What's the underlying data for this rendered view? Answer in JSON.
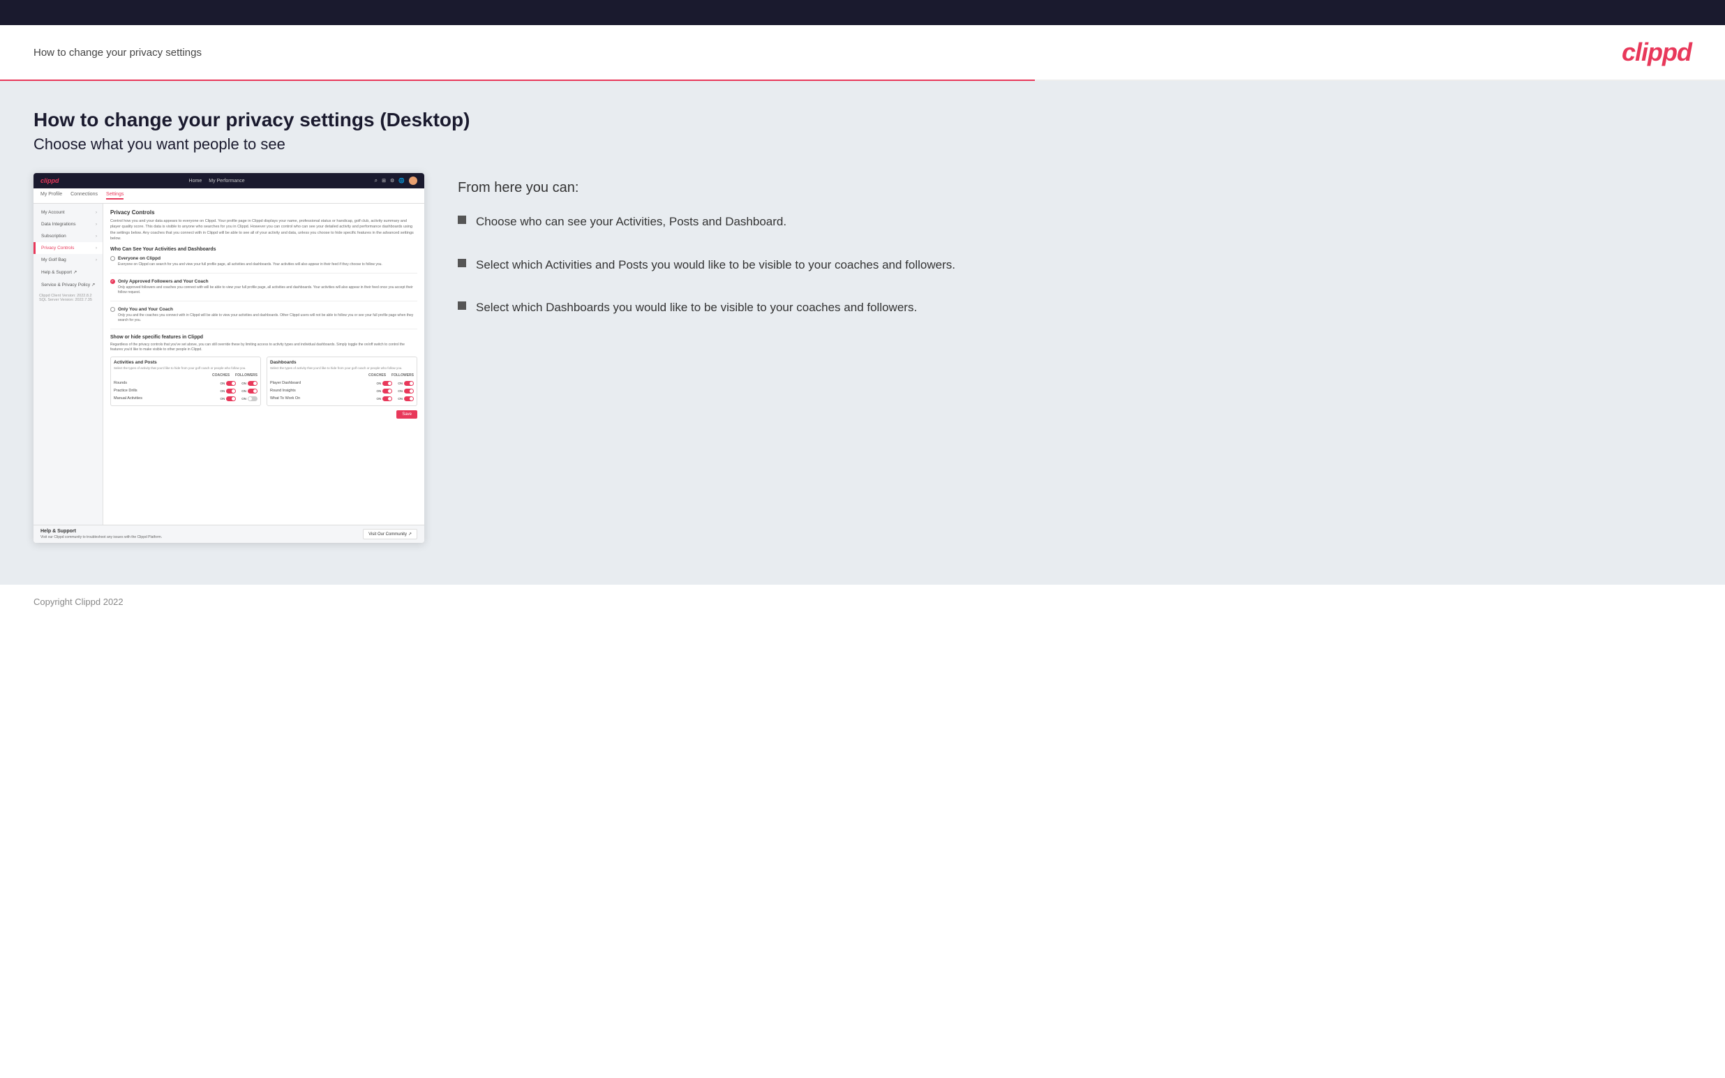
{
  "header": {
    "title": "How to change your privacy settings",
    "logo": "clippd"
  },
  "page": {
    "heading": "How to change your privacy settings (Desktop)",
    "subheading": "Choose what you want people to see",
    "from_here_title": "From here you can:"
  },
  "bullets": [
    {
      "text": "Choose who can see your Activities, Posts and Dashboard."
    },
    {
      "text": "Select which Activities and Posts you would like to be visible to your coaches and followers."
    },
    {
      "text": "Select which Dashboards you would like to be visible to your coaches and followers."
    }
  ],
  "mock": {
    "nav": {
      "logo": "clippd",
      "links": [
        "Home",
        "My Performance"
      ],
      "icons": [
        "search",
        "grid",
        "settings",
        "globe",
        "avatar"
      ]
    },
    "sub_nav": {
      "tabs": [
        "My Profile",
        "Connections",
        "Settings"
      ]
    },
    "sidebar": {
      "items": [
        {
          "label": "My Account",
          "active": false
        },
        {
          "label": "Data Integrations",
          "active": false
        },
        {
          "label": "Subscription",
          "active": false
        },
        {
          "label": "Privacy Controls",
          "active": true
        },
        {
          "label": "My Golf Bag",
          "active": false
        },
        {
          "label": "Help & Support ↗",
          "active": false
        },
        {
          "label": "Service & Privacy Policy ↗",
          "active": false
        }
      ],
      "footer": {
        "line1": "Clippd Client Version: 2022.8.2",
        "line2": "SQL Server Version: 2022.7.35"
      }
    },
    "main": {
      "section_title": "Privacy Controls",
      "description": "Control how you and your data appears to everyone on Clippd. Your profile page in Clippd displays your name, professional status or handicap, golf club, activity summary and player quality score. This data is visible to anyone who searches for you in Clippd. However you can control who can see your detailed activity and performance dashboards using the settings below. Any coaches that you connect with in Clippd will be able to see all of your activity and data, unless you choose to hide specific features in the advanced settings below.",
      "who_can_see_title": "Who Can See Your Activities and Dashboards",
      "radio_options": [
        {
          "label": "Everyone on Clippd",
          "description": "Everyone on Clippd can search for you and view your full profile page, all activities and dashboards. Your activities will also appear in their feed if they choose to follow you.",
          "selected": false
        },
        {
          "label": "Only Approved Followers and Your Coach",
          "description": "Only approved followers and coaches you connect with will be able to view your full profile page, all activities and dashboards. Your activities will also appear in their feed once you accept their follow request.",
          "selected": true
        },
        {
          "label": "Only You and Your Coach",
          "description": "Only you and the coaches you connect with in Clippd will be able to view your activities and dashboards. Other Clippd users will not be able to follow you or see your full profile page when they search for you.",
          "selected": false
        }
      ],
      "show_hide_title": "Show or hide specific features in Clippd",
      "show_hide_desc": "Regardless of the privacy controls that you've set above, you can still override these by limiting access to activity types and individual dashboards. Simply toggle the on/off switch to control the features you'd like to make visible to other people in Clippd.",
      "activities_panel": {
        "title": "Activities and Posts",
        "desc": "Select the types of activity that you'd like to hide from your golf coach or people who follow you.",
        "headers": [
          "COACHES",
          "FOLLOWERS"
        ],
        "rows": [
          {
            "label": "Rounds",
            "coaches": "on",
            "followers": "on"
          },
          {
            "label": "Practice Drills",
            "coaches": "on",
            "followers": "on"
          },
          {
            "label": "Manual Activities",
            "coaches": "on",
            "followers": "off"
          }
        ]
      },
      "dashboards_panel": {
        "title": "Dashboards",
        "desc": "Select the types of activity that you'd like to hide from your golf coach or people who follow you.",
        "headers": [
          "COACHES",
          "FOLLOWERS"
        ],
        "rows": [
          {
            "label": "Player Dashboard",
            "coaches": "on",
            "followers": "on"
          },
          {
            "label": "Round Insights",
            "coaches": "on",
            "followers": "on"
          },
          {
            "label": "What To Work On",
            "coaches": "on",
            "followers": "on"
          }
        ]
      },
      "save_label": "Save"
    },
    "help": {
      "title": "Help & Support",
      "desc": "Visit our Clippd community to troubleshoot any issues with the Clippd Platform.",
      "button": "Visit Our Community ↗"
    }
  },
  "footer": {
    "text": "Copyright Clippd 2022"
  }
}
